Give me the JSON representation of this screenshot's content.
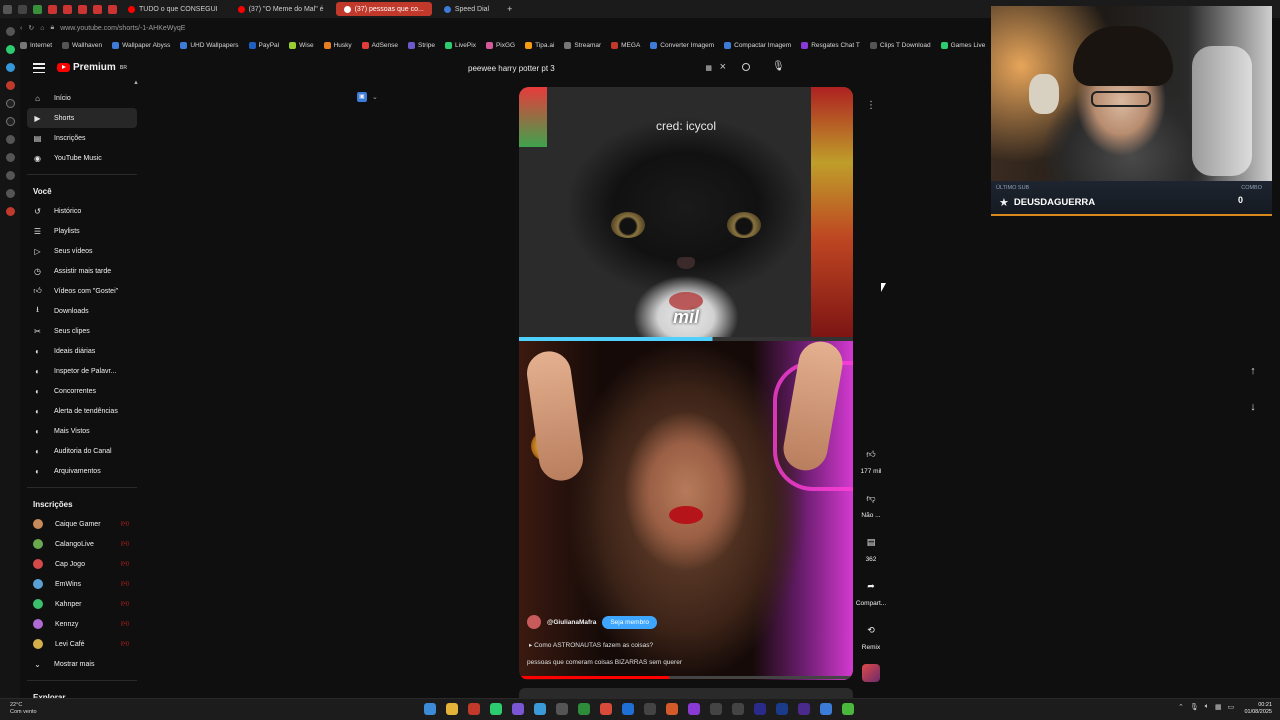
{
  "browser": {
    "tabs": [
      {
        "label": "TUDO o que CONSEGUI",
        "active": false
      },
      {
        "label": "(37) \"O Meme do Mal\" é",
        "active": false
      },
      {
        "label": "(37) pessoas que co...",
        "active": true
      },
      {
        "label": "Speed Dial",
        "active": false
      }
    ],
    "new_tab": "+",
    "url": "www.youtube.com/shorts/-1-AHKeWyqE",
    "bookmarks": [
      "Internet",
      "Wallhaven",
      "Wallpaper Abyss",
      "UHD Wallpapers",
      "PayPal",
      "Wise",
      "Husky",
      "AdSense",
      "Stripe",
      "LivePix",
      "PixGG",
      "Tipa.ai",
      "Streamar",
      "MEGA",
      "Converter Imagem",
      "Compactar Imagem",
      "Resgates Chat T",
      "Clips T Download",
      "Games Live",
      "Wa"
    ]
  },
  "youtube": {
    "logo_text": "Premium",
    "logo_sup": "BR",
    "search_query": "peewee harry potter pt 3",
    "search_kb": "▦",
    "sidebar": {
      "main": [
        {
          "label": "Início",
          "icon": "home-icon",
          "active": false
        },
        {
          "label": "Shorts",
          "icon": "shorts-icon",
          "active": true
        },
        {
          "label": "Inscrições",
          "icon": "subscriptions-icon",
          "active": false
        },
        {
          "label": "YouTube Music",
          "icon": "music-icon",
          "active": false
        }
      ],
      "you_heading": "Você",
      "you_items": [
        {
          "label": "Histórico",
          "icon": "history-icon"
        },
        {
          "label": "Playlists",
          "icon": "playlists-icon"
        },
        {
          "label": "Seus vídeos",
          "icon": "your-videos-icon"
        },
        {
          "label": "Assistir mais tarde",
          "icon": "watch-later-icon"
        },
        {
          "label": "Vídeos com \"Gostei\"",
          "icon": "like-icon"
        },
        {
          "label": "Downloads",
          "icon": "download-icon"
        },
        {
          "label": "Seus clipes",
          "icon": "clips-icon"
        },
        {
          "label": "Ideais diárias",
          "icon": "ideas-icon"
        },
        {
          "label": "Inspetor de Palavr...",
          "icon": "inspector-icon"
        },
        {
          "label": "Concorrentes",
          "icon": "competitors-icon"
        },
        {
          "label": "Alerta de tendências",
          "icon": "trend-icon"
        },
        {
          "label": "Mais Vistos",
          "icon": "most-viewed-icon"
        },
        {
          "label": "Auditoria do Canal",
          "icon": "audit-icon"
        },
        {
          "label": "Arquivamentos",
          "icon": "archive-icon"
        }
      ],
      "subs_heading": "Inscrições",
      "subs": [
        {
          "label": "Caique Gamer",
          "color": "#c98a5a"
        },
        {
          "label": "CalangoLive",
          "color": "#6aa84f"
        },
        {
          "label": "Cap Jogo",
          "color": "#d44a4a"
        },
        {
          "label": "EmWins",
          "color": "#5aa0d4"
        },
        {
          "label": "Kahnper",
          "color": "#3bbf6a"
        },
        {
          "label": "Kennzy",
          "color": "#b06ad4"
        },
        {
          "label": "Levi Café",
          "color": "#d4b04a"
        }
      ],
      "show_more": "Mostrar mais",
      "explore_heading": "Explorar"
    },
    "short": {
      "credit": "cred: icycol",
      "caption": "mil",
      "channel": "@GiulianaMafra",
      "join_label": "Seja membro",
      "link_text": "Como ASTRONAUTAS fazem as coisas?",
      "description": "pessoas que comeram coisas BIZARRAS sem querer",
      "progress": 0.45
    },
    "actions": {
      "likes": "177 mil",
      "dislike": "Não ...",
      "comments": "362",
      "share": "Compart...",
      "remix": "Remix"
    }
  },
  "overlay": {
    "sub_label": "ÚLTIMO SUB",
    "sub_name": "DEUSDAGUERRA",
    "combo_label": "COMBO",
    "combo_value": "0"
  },
  "taskbar": {
    "weather_temp": "22°C",
    "weather_desc": "Com vento",
    "time": "00:21",
    "date": "01/08/2025"
  }
}
